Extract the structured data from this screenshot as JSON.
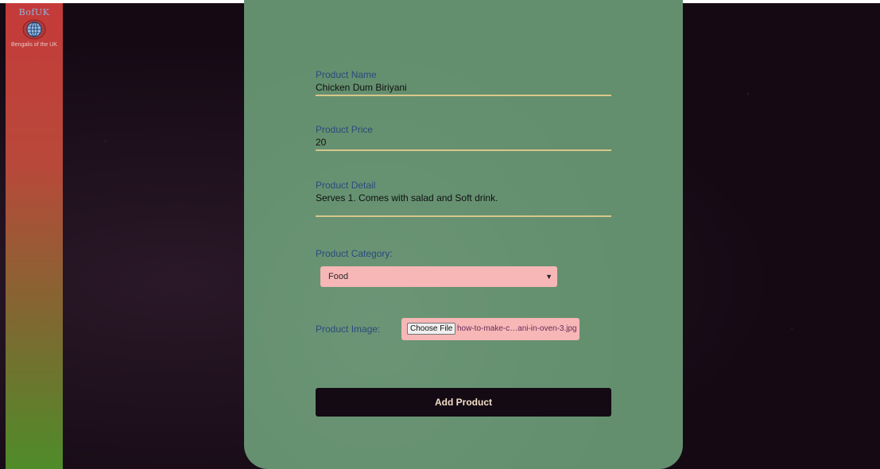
{
  "sidebar": {
    "logo_title": "BofUK",
    "logo_subtitle": "Bengalis of the UK"
  },
  "form": {
    "product_name": {
      "label": "Product Name",
      "value": "Chicken Dum Biriyani"
    },
    "product_price": {
      "label": "Product Price",
      "value": "20"
    },
    "product_detail": {
      "label": "Product Detail",
      "value": "Serves 1. Comes with salad and Soft drink."
    },
    "product_category": {
      "label": "Product Category:",
      "selected": "Food"
    },
    "product_image": {
      "label": "Product Image:",
      "button_label": "Choose File",
      "file_name": "how-to-make-c…ani-in-oven-3.jpg"
    },
    "submit_label": "Add Product"
  },
  "colors": {
    "card": "#638f6e",
    "input_bg": "#f6b7b6",
    "underline": "#d8c78a",
    "button_bg": "#140a14",
    "label": "#2a4a7c"
  },
  "icons": {
    "logo": "globe-icon",
    "select_arrow": "chevron-down-icon"
  }
}
